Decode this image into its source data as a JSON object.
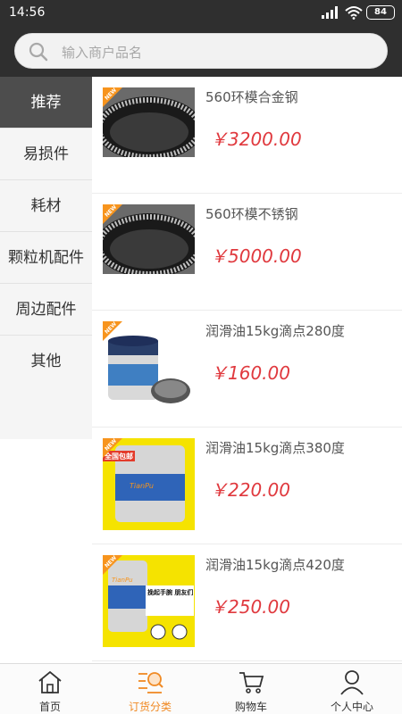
{
  "statusbar": {
    "time": "14:56",
    "battery": "84"
  },
  "search": {
    "placeholder": "输入商户品名",
    "icon": "search-icon"
  },
  "sidebar": {
    "items": [
      {
        "label": "推荐",
        "active": true
      },
      {
        "label": "易损件"
      },
      {
        "label": "耗材"
      },
      {
        "label": "颗粒机配件"
      },
      {
        "label": "周边配件"
      },
      {
        "label": "其他"
      }
    ]
  },
  "products": [
    {
      "name": "560环模合金钢",
      "price": "￥3200.00",
      "badge": "NEW"
    },
    {
      "name": "560环模不锈钢",
      "price": "￥5000.00",
      "badge": "NEW"
    },
    {
      "name": "润滑油15kg滴点280度",
      "price": "￥160.00",
      "badge": "NEW"
    },
    {
      "name": "润滑油15kg滴点380度",
      "price": "￥220.00",
      "badge": "NEW",
      "img_text": "全国包邮",
      "img_brand": "TianPu"
    },
    {
      "name": "润滑油15kg滴点420度",
      "price": "￥250.00",
      "badge": "NEW",
      "img_brand": "TianPu",
      "img_text": "挽起手腕 朋友们 惊呆了"
    }
  ],
  "tabbar": {
    "tabs": [
      {
        "label": "首页",
        "icon": "home-icon"
      },
      {
        "label": "订货分类",
        "icon": "category-icon",
        "active": true
      },
      {
        "label": "购物车",
        "icon": "cart-icon"
      },
      {
        "label": "个人中心",
        "icon": "user-icon"
      }
    ]
  },
  "colors": {
    "accent": "#f08a24",
    "price": "#e0393e",
    "header": "#2f2f2f",
    "sidebar_active": "#4d4d4d"
  }
}
